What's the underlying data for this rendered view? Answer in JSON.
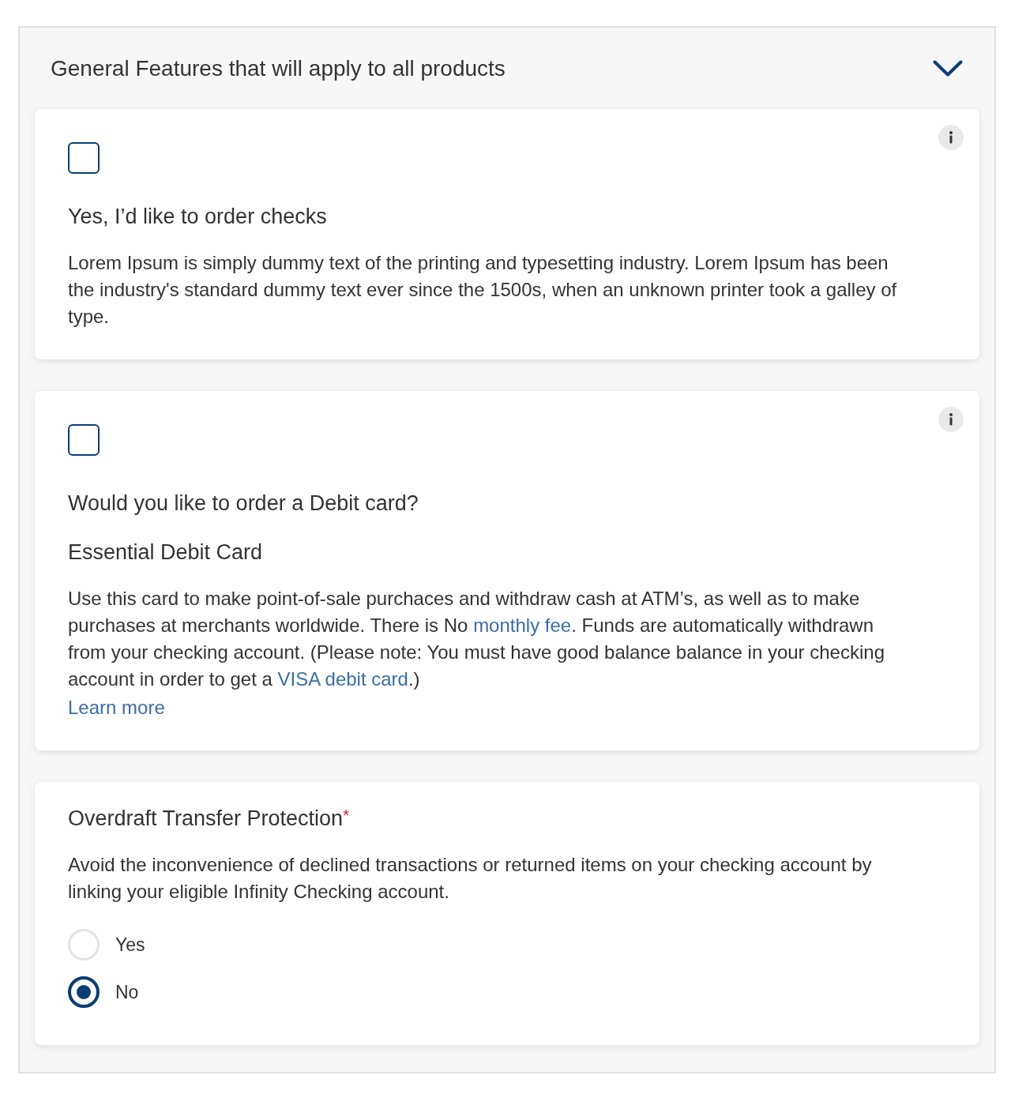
{
  "section": {
    "title": "General Features that will apply to all products",
    "expanded": true
  },
  "cards": [
    {
      "kind": "checkbox",
      "checked": false,
      "info_button": true,
      "title": "Yes, I’d like to order checks",
      "description": [
        {
          "kind": "text",
          "text": "Lorem Ipsum is simply dummy text of the printing and typesetting industry. Lorem Ipsum has been the industry's standard dummy text ever since the 1500s, when an unknown printer took a galley of type."
        }
      ]
    },
    {
      "kind": "checkbox",
      "checked": false,
      "info_button": true,
      "title": "Would you like to order a Debit card?",
      "subtitle": "Essential Debit Card",
      "description": [
        {
          "kind": "text",
          "text": "Use this card to make point-of-sale purchaces and withdraw cash at ATM’s, as well as to make purchases at merchants worldwide. There is No "
        },
        {
          "kind": "link",
          "text": "monthly fee"
        },
        {
          "kind": "text",
          "text": ". Funds are automatically withdrawn from your checking account. (Please note: You must have good balance balance in your checking account in order to get a "
        },
        {
          "kind": "link",
          "text": "VISA debit card"
        },
        {
          "kind": "text",
          "text": ".)"
        }
      ],
      "link": "Learn more"
    },
    {
      "kind": "radio",
      "info_button": false,
      "title": "Overdraft Transfer Protection",
      "required_mark": "*",
      "description": [
        {
          "kind": "text",
          "text": "Avoid the inconvenience of declined transactions or returned items on your checking account by linking your eligible Infinity Checking account."
        }
      ],
      "options": [
        {
          "label": "Yes",
          "selected": false
        },
        {
          "label": "No",
          "selected": true
        }
      ]
    }
  ]
}
